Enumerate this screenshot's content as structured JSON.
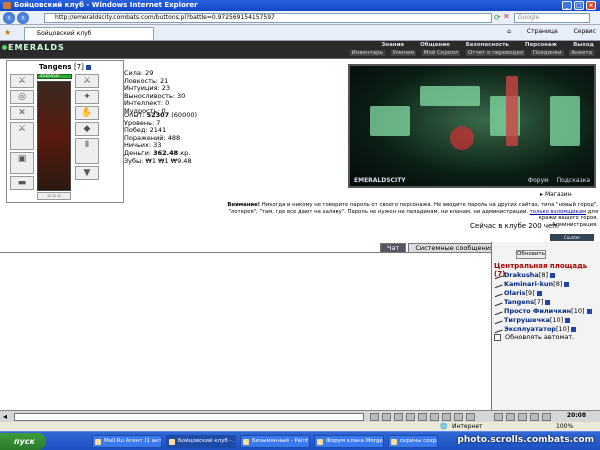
{
  "window": {
    "title": "Бойцовский клуб - Windows Internet Explorer"
  },
  "address": {
    "url": "http://emeraldscity.combats.com/buttons.pl?battle=0.972569154157597",
    "search_placeholder": "Google"
  },
  "tab": {
    "label": "Бойцовский клуб"
  },
  "toolbar": {
    "items": [
      "Страница",
      "Сервис"
    ]
  },
  "game": {
    "logo": "EMERALDS",
    "menu": [
      "Знание",
      "Общение",
      "Безопасность",
      "Персонаж",
      "Выход"
    ],
    "submenu": [
      "Инвентарь",
      "Умения",
      "Мой Скролл",
      "Отчет о переводах",
      "Поединки",
      "Анкета"
    ]
  },
  "character": {
    "name": "Tangens",
    "level": "[7]",
    "hp": "450/450",
    "stats": [
      "Сила: 29",
      "Ловкость: 21",
      "Интуиция: 23",
      "Выносливость: 30",
      "Интеллект: 0",
      "Мудрость: 0"
    ],
    "exp_label": "Опыт:",
    "exp_value": "52307",
    "exp_next": "(60000)",
    "details": [
      "Уровень: 7",
      "Побед: 2141",
      "Поражений: 488",
      "Ничьих: 33"
    ],
    "money_label": "Деньги:",
    "money_value": "362.48",
    "money_unit": "кр.",
    "teeth": "Зубы: ₩1 ₩1 ₩9.48"
  },
  "scene": {
    "city": "EMERALDSCITY",
    "links": [
      "Форум",
      "Подсказка"
    ]
  },
  "shop": {
    "label": "Магазин"
  },
  "warning": {
    "bold": "Внимание!",
    "text": "Никогда и никому не говорите пароль от своего персонажа. Не вводите пароль на других сайтах, типа \"новый город\", \"лотерея\", \"там, где все дают на халяву\". Пароль не нужен ни паладинам, ни кланам, ни администрации,",
    "link": "только взломщикам",
    "tail": "для кражи вашего героя.",
    "sign": "Администрация."
  },
  "online": {
    "text": "Сейчас в клубе 200 чел."
  },
  "counter": {
    "text": "Counter"
  },
  "chat": {
    "tabs": [
      "Чат",
      "Системные сообщения"
    ]
  },
  "sidebar": {
    "refresh_label": "Обновить",
    "room_title": "Центральная площадь (7)",
    "players": [
      {
        "name": "Drakusha",
        "level": "[8]"
      },
      {
        "name": "Kaminari-kun",
        "level": "[8]"
      },
      {
        "name": "Olaris",
        "level": "[9]"
      },
      {
        "name": "Tangens",
        "level": "[7]"
      },
      {
        "name": "Просто Филичкин",
        "level": "[10]"
      },
      {
        "name": "Тигрушечка",
        "level": "[10]"
      },
      {
        "name": "Эксплуататор",
        "level": "[10]"
      }
    ],
    "auto_refresh": "Обновлять автомат."
  },
  "status": {
    "zone": "Интернет"
  },
  "clock": {
    "time": "20:08"
  },
  "taskbar": {
    "start": "пуск",
    "items": [
      "Mail.Ru Агент (1 акт...",
      "Бойцовский клуб - ...",
      "Безымянный - Paint",
      "Форум клана Morgen...",
      "скрины сохраненные"
    ],
    "watermark": "photo.scrolls.combats.com"
  },
  "colors": {
    "accent": "#1147c4",
    "room_title": "#aa0000",
    "player_name": "#002a80"
  }
}
